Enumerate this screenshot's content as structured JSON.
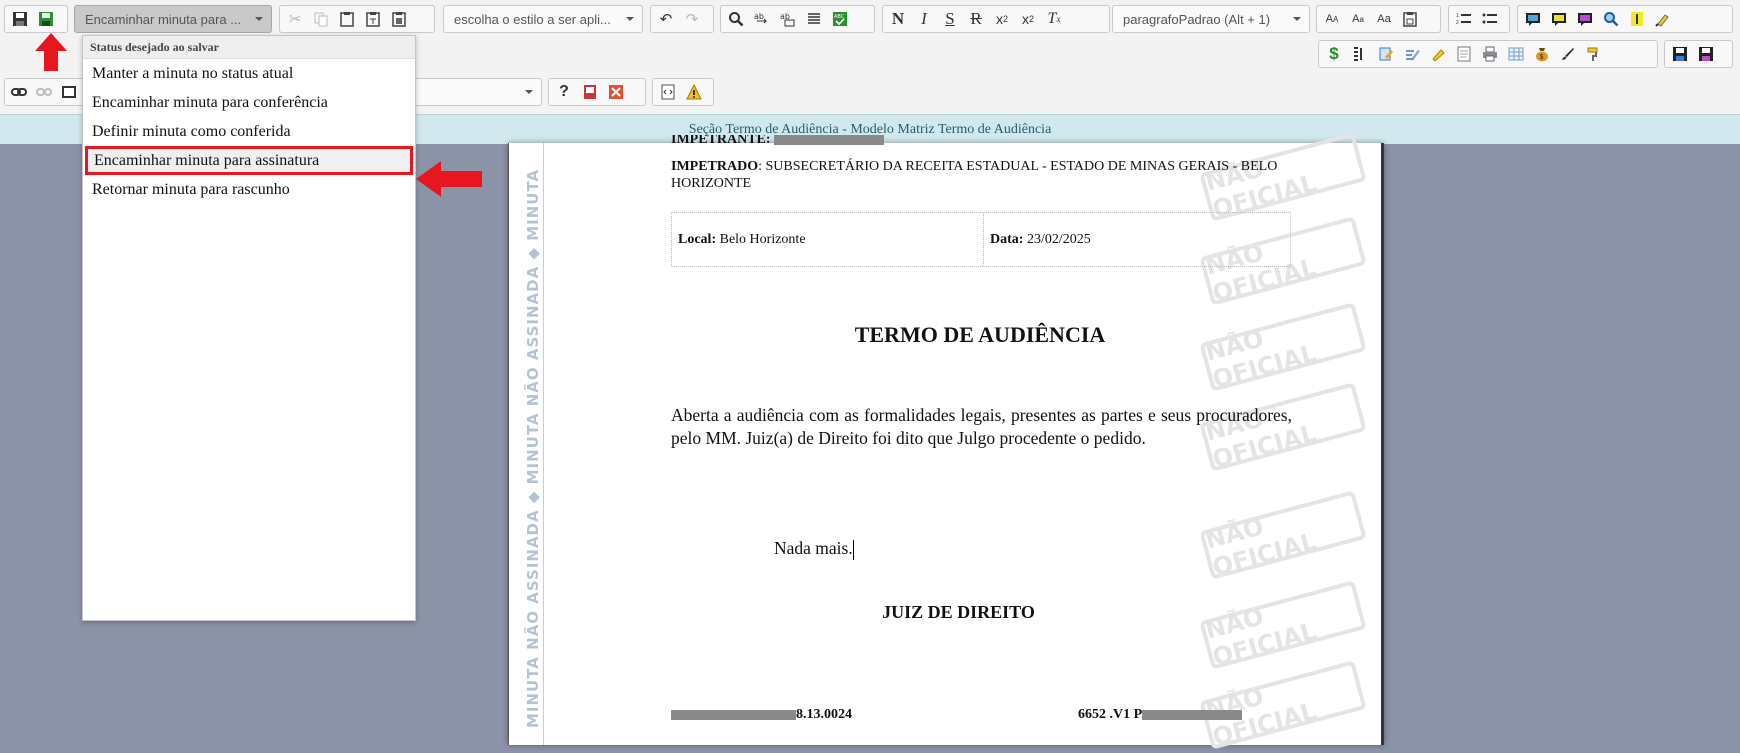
{
  "toolbar": {
    "status_combo": "Encaminhar minuta para ...",
    "style_combo": "escolha o estilo a ser apli...",
    "paragraph_combo": "paragrafoPadrao (Alt + 1)",
    "bold_glyph": "N",
    "italic_glyph": "I",
    "underline_glyph": "S",
    "strike_glyph": "R"
  },
  "dropdown": {
    "header": "Status desejado ao salvar",
    "options": [
      "Manter a minuta no status atual",
      "Encaminhar minuta para conferência",
      "Definir minuta como conferida",
      "Encaminhar minuta para assinatura",
      "Retornar minuta para rascunho"
    ],
    "selected_index": 3
  },
  "section_title": "Seção Termo de Audiência - Modelo Matriz Termo de Audiência",
  "watermarks": {
    "side": "MINUTA NÃO ASSINADA ◆ MINUTA NÃO ASSINADA ◆ MINUTA",
    "stamp": "NÃO OFICIAL"
  },
  "document": {
    "impetrante_label": "IMPETRANTE",
    "impetrado_label": "IMPETRADO",
    "impetrado_value": ": SUBSECRETÁRIO DA RECEITA ESTADUAL - ESTADO DE MINAS GERAIS - BELO HORIZONTE",
    "local_label": "Local:",
    "local_value": "Belo Horizonte",
    "data_label": "Data:",
    "data_value": "23/02/2025",
    "title": "TERMO DE AUDIÊNCIA",
    "body": "Aberta a audiência com as formalidades legais, presentes as partes e seus procuradores, pelo MM. Juiz(a) de Direito foi dito que Julgo procedente o pedido.",
    "closing": "Nada mais.",
    "signature": "JUIZ DE DIREITO",
    "footer_left": "8.13.0024",
    "footer_right": "6652 .V1 P"
  },
  "colors": {
    "annotation_red": "#e8161f",
    "section_bar": "#d2e8ef",
    "workspace": "#8b94a7"
  }
}
